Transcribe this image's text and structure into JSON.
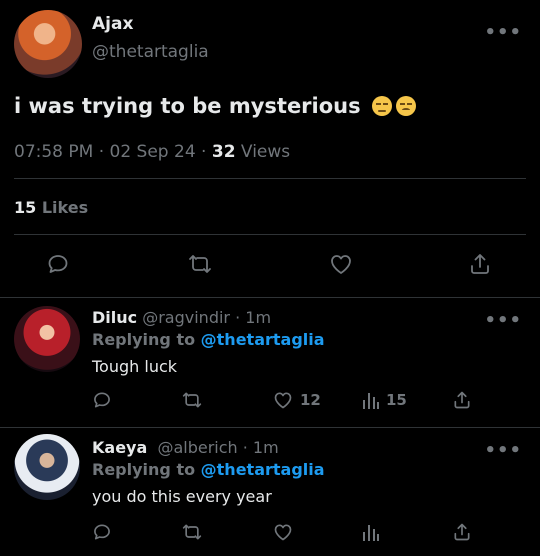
{
  "tweet": {
    "name": "Ajax",
    "handle": "@thetartaglia",
    "text": "i was trying to be mysterious",
    "emojis": [
      "pensive-face",
      "frowning-face"
    ],
    "time": "07:58 PM · 02 Sep 24 · ",
    "views_count": "32",
    "views_label": " Views",
    "likes_count": "15",
    "likes_label": " Likes",
    "more": "•••"
  },
  "replies": [
    {
      "name": "Diluc",
      "handle": "@ragvindir",
      "time": " · 1m",
      "replying_prefix": "Replying to ",
      "replying_to": "@thetartaglia",
      "text": "Tough luck",
      "likes": "12",
      "views": "15"
    },
    {
      "name": "Kaeya",
      "handle": "@alberich",
      "time": " · 1m",
      "replying_prefix": "Replying to ",
      "replying_to": "@thetartaglia",
      "text": "you do this every year",
      "likes": "",
      "views": ""
    }
  ],
  "icons": [
    "reply-icon",
    "retweet-icon",
    "like-icon",
    "share-icon",
    "views-icon",
    "more-icon"
  ],
  "colors": {
    "background": "#000000",
    "text": "#e7e9ea",
    "muted": "#71767b",
    "link": "#1d9bf0",
    "divider": "#2f3336"
  }
}
